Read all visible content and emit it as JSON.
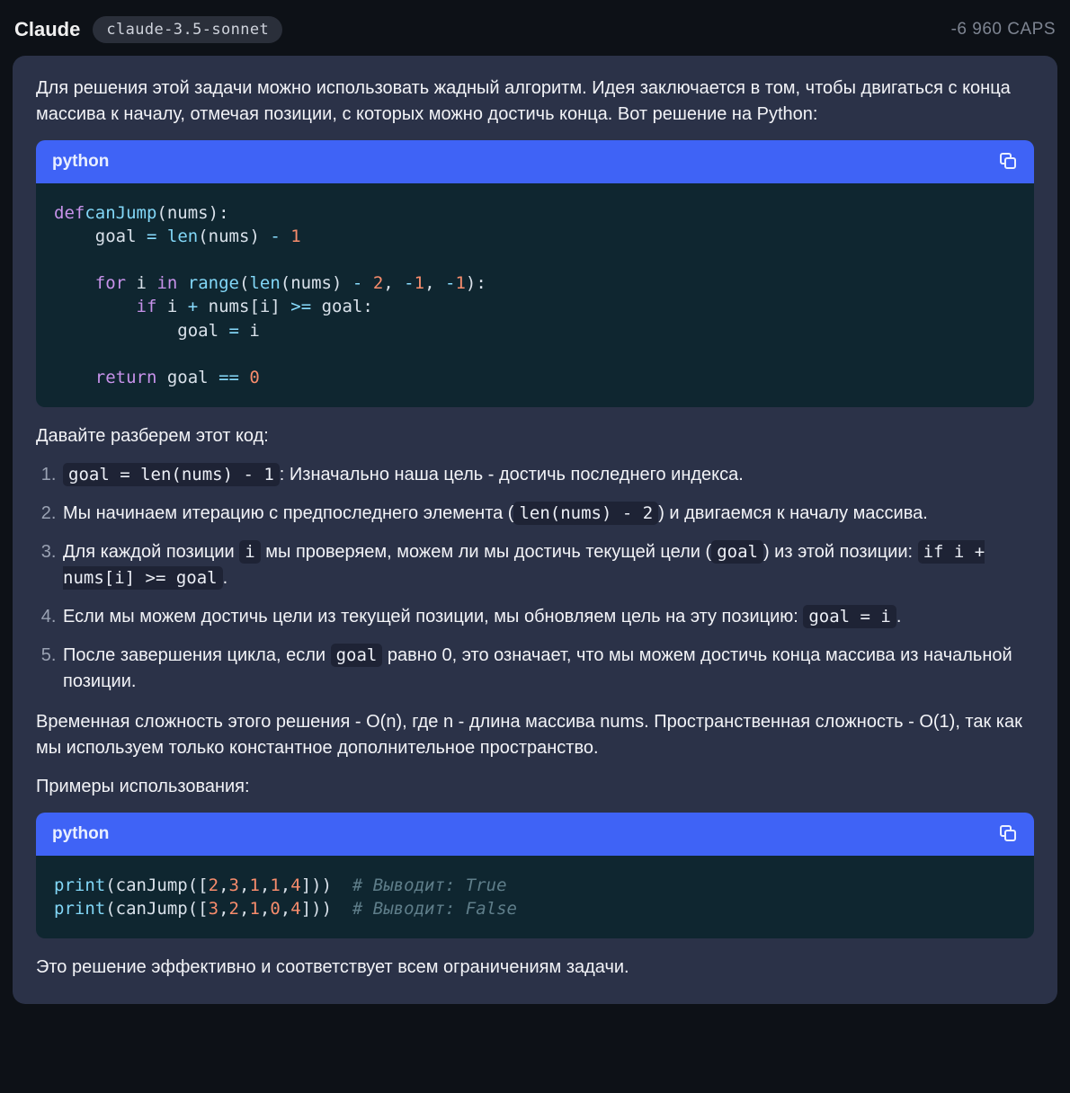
{
  "header": {
    "title": "Claude",
    "model": "claude-3.5-sonnet",
    "caps": "-6 960 CAPS"
  },
  "message": {
    "intro": "Для решения этой задачи можно использовать жадный алгоритм. Идея заключается в том, чтобы двигаться с конца массива к началу, отмечая позиции, с которых можно достичь конца. Вот решение на Python:",
    "code1": {
      "lang": "python",
      "tokens": [
        [
          [
            "kw",
            "def"
          ],
          [
            "",
            ""
          ],
          [
            "fn",
            "canJump"
          ],
          [
            "pun",
            "("
          ],
          [
            "var",
            "nums"
          ],
          [
            "pun",
            "):"
          ]
        ],
        [
          [
            "",
            "    "
          ],
          [
            "var",
            "goal"
          ],
          [
            "",
            " "
          ],
          [
            "op",
            "="
          ],
          [
            "",
            " "
          ],
          [
            "fn",
            "len"
          ],
          [
            "pun",
            "("
          ],
          [
            "var",
            "nums"
          ],
          [
            "pun",
            ")"
          ],
          [
            "",
            " "
          ],
          [
            "op",
            "-"
          ],
          [
            "",
            " "
          ],
          [
            "num",
            "1"
          ]
        ],
        [
          [
            "",
            ""
          ]
        ],
        [
          [
            "",
            "    "
          ],
          [
            "kw",
            "for"
          ],
          [
            "",
            " "
          ],
          [
            "var",
            "i"
          ],
          [
            "",
            " "
          ],
          [
            "kw",
            "in"
          ],
          [
            "",
            " "
          ],
          [
            "fn",
            "range"
          ],
          [
            "pun",
            "("
          ],
          [
            "fn",
            "len"
          ],
          [
            "pun",
            "("
          ],
          [
            "var",
            "nums"
          ],
          [
            "pun",
            ")"
          ],
          [
            "",
            " "
          ],
          [
            "op",
            "-"
          ],
          [
            "",
            " "
          ],
          [
            "num",
            "2"
          ],
          [
            "pun",
            ","
          ],
          [
            "",
            " "
          ],
          [
            "op",
            "-"
          ],
          [
            "num",
            "1"
          ],
          [
            "pun",
            ","
          ],
          [
            "",
            " "
          ],
          [
            "op",
            "-"
          ],
          [
            "num",
            "1"
          ],
          [
            "pun",
            "):"
          ]
        ],
        [
          [
            "",
            "        "
          ],
          [
            "kw",
            "if"
          ],
          [
            "",
            " "
          ],
          [
            "var",
            "i"
          ],
          [
            "",
            " "
          ],
          [
            "op",
            "+"
          ],
          [
            "",
            " "
          ],
          [
            "var",
            "nums"
          ],
          [
            "pun",
            "["
          ],
          [
            "var",
            "i"
          ],
          [
            "pun",
            "]"
          ],
          [
            "",
            " "
          ],
          [
            "op",
            ">="
          ],
          [
            "",
            " "
          ],
          [
            "var",
            "goal"
          ],
          [
            "pun",
            ":"
          ]
        ],
        [
          [
            "",
            "            "
          ],
          [
            "var",
            "goal"
          ],
          [
            "",
            " "
          ],
          [
            "op",
            "="
          ],
          [
            "",
            " "
          ],
          [
            "var",
            "i"
          ]
        ],
        [
          [
            "",
            ""
          ]
        ],
        [
          [
            "",
            "    "
          ],
          [
            "kw",
            "return"
          ],
          [
            "",
            " "
          ],
          [
            "var",
            "goal"
          ],
          [
            "",
            " "
          ],
          [
            "op",
            "=="
          ],
          [
            "",
            " "
          ],
          [
            "num",
            "0"
          ]
        ]
      ]
    },
    "explain_intro": "Давайте разберем этот код:",
    "explain": [
      {
        "parts": [
          {
            "code": "goal = len(nums) - 1"
          },
          {
            "text": ": Изначально наша цель - достичь последнего индекса."
          }
        ]
      },
      {
        "parts": [
          {
            "text": "Мы начинаем итерацию с предпоследнего элемента ("
          },
          {
            "code": "len(nums) - 2"
          },
          {
            "text": ") и двигаемся к началу массива."
          }
        ]
      },
      {
        "parts": [
          {
            "text": "Для каждой позиции "
          },
          {
            "code": "i"
          },
          {
            "text": " мы проверяем, можем ли мы достичь текущей цели ("
          },
          {
            "code": "goal"
          },
          {
            "text": ") из этой позиции: "
          },
          {
            "code": "if i + nums[i] >= goal"
          },
          {
            "text": "."
          }
        ]
      },
      {
        "parts": [
          {
            "text": "Если мы можем достичь цели из текущей позиции, мы обновляем цель на эту позицию: "
          },
          {
            "code": "goal = i"
          },
          {
            "text": "."
          }
        ]
      },
      {
        "parts": [
          {
            "text": "После завершения цикла, если "
          },
          {
            "code": "goal"
          },
          {
            "text": " равно 0, это означает, что мы можем достичь конца массива из начальной позиции."
          }
        ]
      }
    ],
    "complexity": "Временная сложность этого решения - O(n), где n - длина массива nums. Пространственная сложность - O(1), так как мы используем только константное дополнительное пространство.",
    "examples_intro": "Примеры использования:",
    "code2": {
      "lang": "python",
      "tokens": [
        [
          [
            "fn",
            "print"
          ],
          [
            "pun",
            "("
          ],
          [
            "var",
            "canJump"
          ],
          [
            "pun",
            "(["
          ],
          [
            "num",
            "2"
          ],
          [
            "pun",
            ","
          ],
          [
            "num",
            "3"
          ],
          [
            "pun",
            ","
          ],
          [
            "num",
            "1"
          ],
          [
            "pun",
            ","
          ],
          [
            "num",
            "1"
          ],
          [
            "pun",
            ","
          ],
          [
            "num",
            "4"
          ],
          [
            "pun",
            "]))"
          ],
          [
            "",
            "  "
          ],
          [
            "cmt",
            "# Выводит: True"
          ]
        ],
        [
          [
            "fn",
            "print"
          ],
          [
            "pun",
            "("
          ],
          [
            "var",
            "canJump"
          ],
          [
            "pun",
            "(["
          ],
          [
            "num",
            "3"
          ],
          [
            "pun",
            ","
          ],
          [
            "num",
            "2"
          ],
          [
            "pun",
            ","
          ],
          [
            "num",
            "1"
          ],
          [
            "pun",
            ","
          ],
          [
            "num",
            "0"
          ],
          [
            "pun",
            ","
          ],
          [
            "num",
            "4"
          ],
          [
            "pun",
            "]))"
          ],
          [
            "",
            "  "
          ],
          [
            "cmt",
            "# Выводит: False"
          ]
        ]
      ]
    },
    "outro": "Это решение эффективно и соответствует всем ограничениям задачи."
  }
}
